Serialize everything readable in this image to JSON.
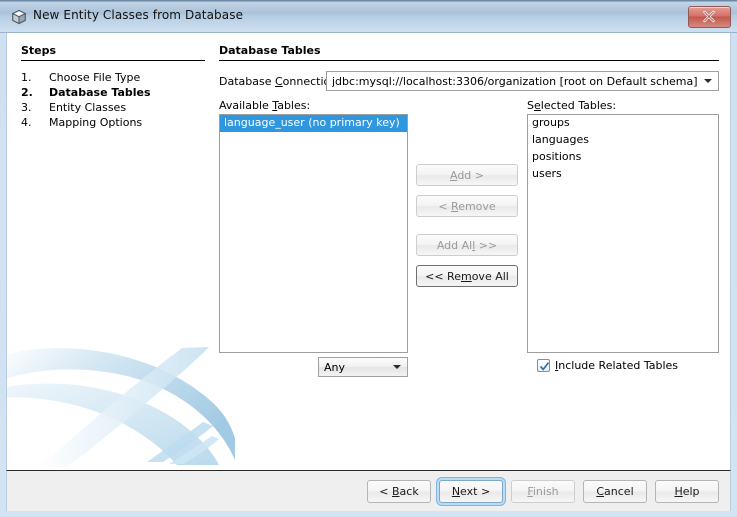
{
  "window": {
    "title": "New Entity Classes from Database",
    "icon": "cube-icon",
    "close_label": "x"
  },
  "steps": {
    "heading": "Steps",
    "items": [
      {
        "num": "1.",
        "label": "Choose File Type",
        "current": false
      },
      {
        "num": "2.",
        "label": "Database Tables",
        "current": true
      },
      {
        "num": "3.",
        "label": "Entity Classes",
        "current": false
      },
      {
        "num": "4.",
        "label": "Mapping Options",
        "current": false
      }
    ]
  },
  "main": {
    "heading": "Database Tables",
    "connection": {
      "label_pre": "Database ",
      "label_mn": "C",
      "label_post": "onnection:",
      "value": "jdbc:mysql://localhost:3306/organization [root on Default schema]"
    },
    "available": {
      "label_pre": "Available ",
      "label_mn": "T",
      "label_post": "ables:",
      "items": [
        {
          "label": "language_user (no primary key)",
          "selected": true
        }
      ],
      "filter": {
        "value": "Any"
      }
    },
    "selected": {
      "label_pre": "S",
      "label_mn": "e",
      "label_post": "lected Tables:",
      "items": [
        {
          "label": "groups",
          "selected": false
        },
        {
          "label": "languages",
          "selected": false
        },
        {
          "label": "positions",
          "selected": false
        },
        {
          "label": "users",
          "selected": false
        }
      ]
    },
    "transfer_buttons": [
      {
        "pre": "",
        "mn": "A",
        "post": "dd >",
        "enabled": false,
        "strong": false
      },
      {
        "pre": "< ",
        "mn": "R",
        "post": "emove",
        "enabled": false,
        "strong": false
      },
      {
        "pre": "Add Al",
        "mn": "l",
        "post": " >>",
        "enabled": false,
        "strong": false
      },
      {
        "pre": "<< Re",
        "mn": "m",
        "post": "ove All",
        "enabled": true,
        "strong": true
      }
    ],
    "include_related": {
      "checked": true,
      "label_pre": "",
      "label_mn": "I",
      "label_post": "nclude Related Tables"
    }
  },
  "footer": {
    "buttons": [
      {
        "pre": "< ",
        "mn": "B",
        "post": "ack",
        "enabled": true,
        "focus": false
      },
      {
        "pre": "",
        "mn": "N",
        "post": "ext >",
        "enabled": true,
        "focus": true
      },
      {
        "pre": "",
        "mn": "F",
        "post": "inish",
        "enabled": false,
        "focus": false
      },
      {
        "pre": "",
        "mn": "C",
        "post": "ancel",
        "enabled": true,
        "focus": false
      },
      {
        "pre": "",
        "mn": "H",
        "post": "elp",
        "enabled": true,
        "focus": false
      }
    ]
  },
  "colors": {
    "selection": "#2f96e0",
    "titlebar": "#a9c2da",
    "close": "#c2564d",
    "focus_ring": "#7fb6dd"
  }
}
